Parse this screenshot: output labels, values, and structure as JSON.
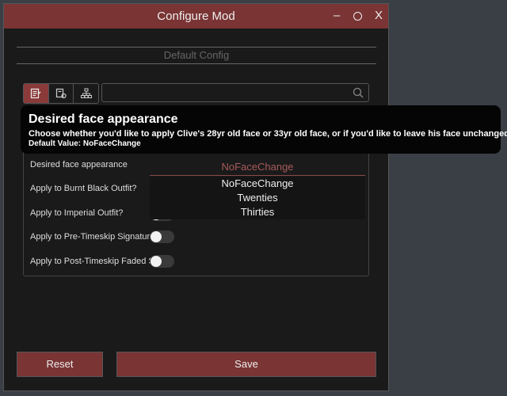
{
  "window": {
    "title": "Configure Mod",
    "controls": {
      "minimize": "–",
      "maximize": "",
      "close": "X"
    }
  },
  "config": {
    "label": "Default Config"
  },
  "toolbar": {
    "icons": [
      "config-list-icon",
      "gamepad-icon",
      "hierarchy-icon"
    ],
    "active_icon": 0
  },
  "search": {
    "placeholder": "",
    "value": ""
  },
  "settings": [
    {
      "label": "Desired face appearance",
      "type": "select",
      "value": "NoFaceChange"
    },
    {
      "label": "Apply to Burnt Black Outfit?",
      "type": "toggle",
      "on": false
    },
    {
      "label": "Apply to Imperial Outfit?",
      "type": "toggle",
      "on": false
    },
    {
      "label": "Apply to Pre-Timeskip Signatur...",
      "type": "toggle",
      "on": false
    },
    {
      "label": "Apply to Post-Timeskip Faded S...",
      "type": "toggle",
      "on": false
    }
  ],
  "dropdown": {
    "selected": "NoFaceChange",
    "options": [
      "NoFaceChange",
      "Twenties",
      "Thirties"
    ]
  },
  "tooltip": {
    "title": "Desired face appearance",
    "description": "Choose whether you'd like to apply Clive's 28yr old face or 33yr old face, or if you'd like to leave his face unchanged.",
    "default_value": "Default Value:  NoFaceChange"
  },
  "buttons": {
    "reset": "Reset",
    "save": "Save"
  },
  "colors": {
    "accent": "#7a3434",
    "active_icon_bg": "#8b3a3a",
    "background": "#1a1a1a",
    "desktop": "#3a3f45",
    "selected_text": "#a85a5a"
  }
}
